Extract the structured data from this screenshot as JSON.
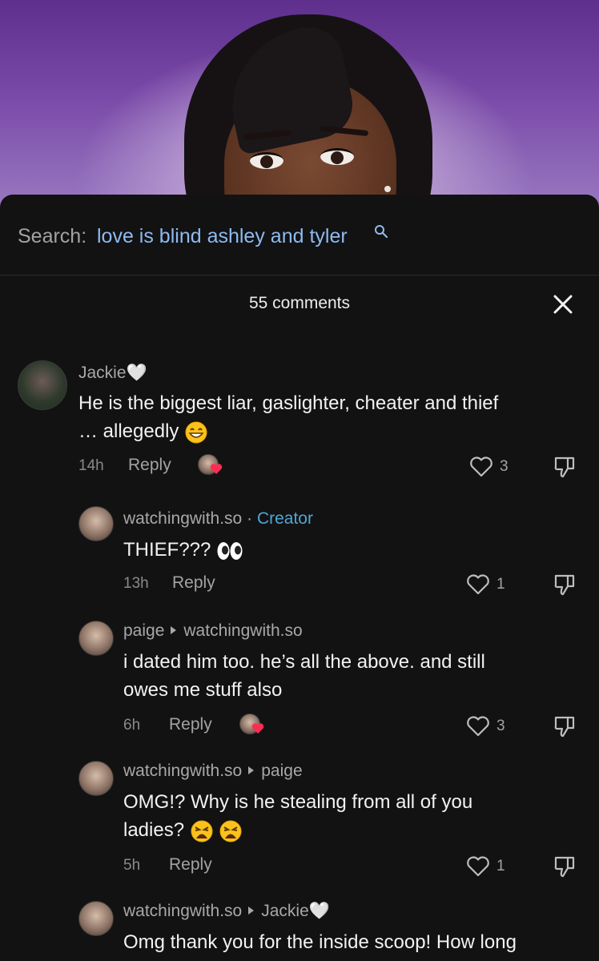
{
  "search": {
    "label": "Search:",
    "term": "love is blind ashley and tyler"
  },
  "header": {
    "title": "55 comments"
  },
  "comments": [
    {
      "username": "Jackie🤍",
      "text_line1": "He is the biggest liar, gaslighter, cheater and thief",
      "text_line2": "… allegedly",
      "time": "14h",
      "reply": "Reply",
      "likes": "3"
    },
    {
      "username": "watchingwith.so",
      "sep": "·",
      "badge": "Creator",
      "text": "THIEF???",
      "time": "13h",
      "reply": "Reply",
      "likes": "1"
    },
    {
      "username": "paige",
      "reply_to": "watchingwith.so",
      "text_line1": "i dated him too. he’s all the above. and still",
      "text_line2": "owes me stuff also",
      "time": "6h",
      "reply": "Reply",
      "likes": "3"
    },
    {
      "username": "watchingwith.so",
      "reply_to": "paige",
      "text_line1": "OMG!? Why is he stealing from all of you",
      "text_line2": "ladies?",
      "time": "5h",
      "reply": "Reply",
      "likes": "1"
    },
    {
      "username": "watchingwith.so",
      "reply_to": "Jackie🤍",
      "text_line1": "Omg thank you for the inside scoop! How long"
    }
  ],
  "colors": {
    "background": "#121212",
    "search_term": "#8ebaf0",
    "creator_badge": "#50a6d6",
    "like_heart": "#fe2c55"
  },
  "icons": [
    "search-icon",
    "close-icon",
    "heart-outline-icon",
    "thumbs-down-icon",
    "creator-liked-heart-icon",
    "grinning-emoji",
    "eyes-emoji",
    "weary-face-emoji"
  ]
}
